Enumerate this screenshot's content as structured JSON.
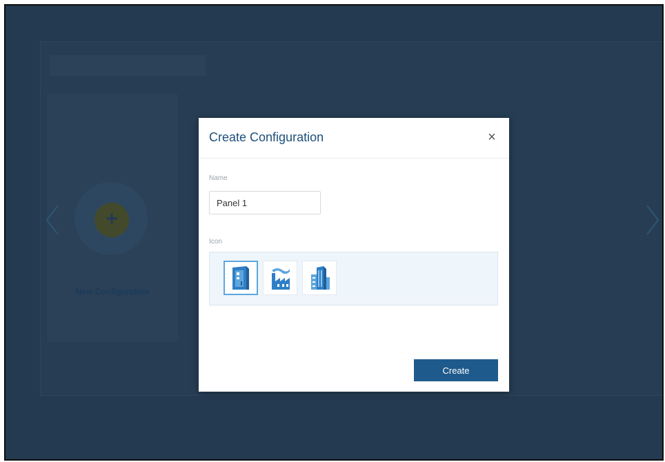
{
  "background": {
    "card_label": "New Configuration"
  },
  "modal": {
    "title": "Create Configuration",
    "close_glyph": "×",
    "name_label": "Name",
    "name_value": "Panel 1",
    "icon_label": "Icon",
    "icons": [
      {
        "name": "panel-icon",
        "selected": true
      },
      {
        "name": "factory-icon",
        "selected": false
      },
      {
        "name": "office-building-icon",
        "selected": false
      }
    ],
    "create_label": "Create"
  },
  "colors": {
    "backdrop": "#243a50",
    "accent": "#1f5a8c",
    "title": "#1e4f7a",
    "icon_blue": "#2f7fc6"
  }
}
